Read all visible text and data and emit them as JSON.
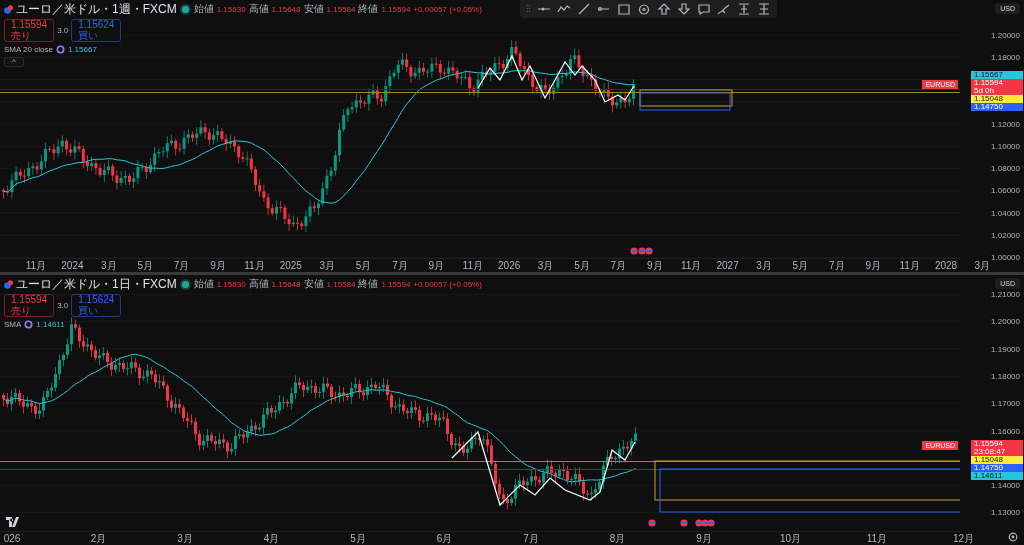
{
  "panes": [
    {
      "title": "ユーロ／米ドル・1週・FXCM",
      "ohlc": [
        {
          "label": "始値",
          "value": "1.15630"
        },
        {
          "label": "高値",
          "value": "1.15648"
        },
        {
          "label": "安値",
          "value": "1.15584"
        },
        {
          "label": "終値",
          "value": "1.15594"
        }
      ],
      "change": "+0.00057 (+0.05%)",
      "sell": {
        "price": "1.15594",
        "label": "売り"
      },
      "spread": "3.0",
      "buy": {
        "price": "1.15624",
        "label": "買い"
      },
      "indicator": {
        "name": "SMA",
        "params": "20 close",
        "value": "1.15667"
      },
      "collapse": "^",
      "currency": "USD",
      "y_axis": [
        "1.20000",
        "1.18000",
        "1.12000",
        "1.10000",
        "1.08000",
        "1.06000",
        "1.04000",
        "1.02000",
        "1.00000"
      ],
      "x_axis": [
        "11月",
        "2024",
        "3月",
        "5月",
        "7月",
        "9月",
        "11月",
        "2025",
        "3月",
        "5月",
        "7月",
        "9月",
        "11月",
        "2026",
        "3月",
        "5月",
        "7月",
        "9月",
        "11月",
        "2027",
        "3月",
        "5月",
        "7月",
        "9月",
        "11月",
        "2028",
        "3月"
      ],
      "symbol_tag": "EURUSD",
      "price_labels": [
        {
          "text": "1.15667",
          "color": "#26c6da"
        },
        {
          "text": "1.15594",
          "sub": "5d 0h",
          "color": "#f23645"
        },
        {
          "text": "1.15048",
          "color": "#ffeb3b"
        },
        {
          "text": "1.14750",
          "color": "#2962ff"
        }
      ]
    },
    {
      "title": "ユーロ／米ドル・1日・FXCM",
      "ohlc": [
        {
          "label": "始値",
          "value": "1.15630"
        },
        {
          "label": "高値",
          "value": "1.15648"
        },
        {
          "label": "安値",
          "value": "1.15584"
        },
        {
          "label": "終値",
          "value": "1.15594"
        }
      ],
      "change": "+0.00057 (+0.05%)",
      "sell": {
        "price": "1.15594",
        "label": "売り"
      },
      "spread": "3.0",
      "buy": {
        "price": "1.15624",
        "label": "買い"
      },
      "indicator": {
        "name": "SMA",
        "value": "1.14611"
      },
      "currency": "USD",
      "y_axis": [
        "1.21000",
        "1.20000",
        "1.19000",
        "1.18000",
        "1.17000",
        "1.16000",
        "1.14000",
        "1.13000"
      ],
      "x_axis": [
        "026",
        "2月",
        "3月",
        "4月",
        "5月",
        "6月",
        "7月",
        "8月",
        "9月",
        "10月",
        "11月",
        "12月"
      ],
      "symbol_tag": "EURUSD",
      "price_labels": [
        {
          "text": "1.15594",
          "sub": "23:08:47",
          "color": "#f23645"
        },
        {
          "text": "1.15048",
          "color": "#ffeb3b"
        },
        {
          "text": "1.14750",
          "color": "#2962ff"
        },
        {
          "text": "1.14611",
          "color": "#26c6da"
        }
      ]
    }
  ]
}
